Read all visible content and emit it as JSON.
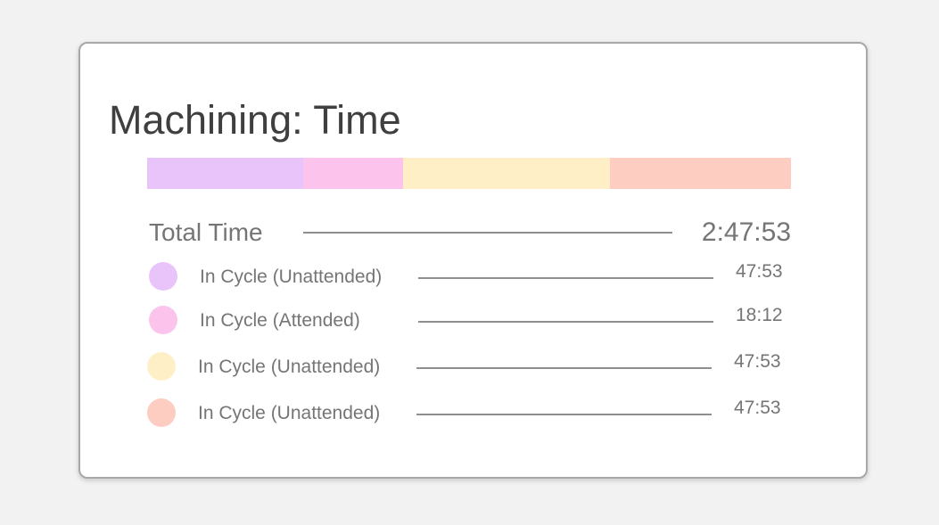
{
  "panel": {
    "title": "Machining: Time"
  },
  "time_bar": {
    "segments": [
      {
        "name": "in-cycle-unattended-1",
        "color": "#e9c4fb",
        "fraction": 0.243
      },
      {
        "name": "in-cycle-attended",
        "color": "#fcc3ec",
        "fraction": 0.155
      },
      {
        "name": "in-cycle-unattended-2",
        "color": "#feefc6",
        "fraction": 0.321
      },
      {
        "name": "in-cycle-unattended-3",
        "color": "#fecdc1",
        "fraction": 0.281
      }
    ]
  },
  "total": {
    "label": "Total Time",
    "value": "2:47:53"
  },
  "legend": [
    {
      "label": "In Cycle (Unattended)",
      "value": "47:53",
      "color": "#e9c4fb"
    },
    {
      "label": "In Cycle (Attended)",
      "value": "18:12",
      "color": "#fcc3ec"
    },
    {
      "label": "In Cycle (Unattended)",
      "value": "47:53",
      "color": "#feefc6"
    },
    {
      "label": "In Cycle (Unattended)",
      "value": "47:53",
      "color": "#fecdc1"
    }
  ]
}
